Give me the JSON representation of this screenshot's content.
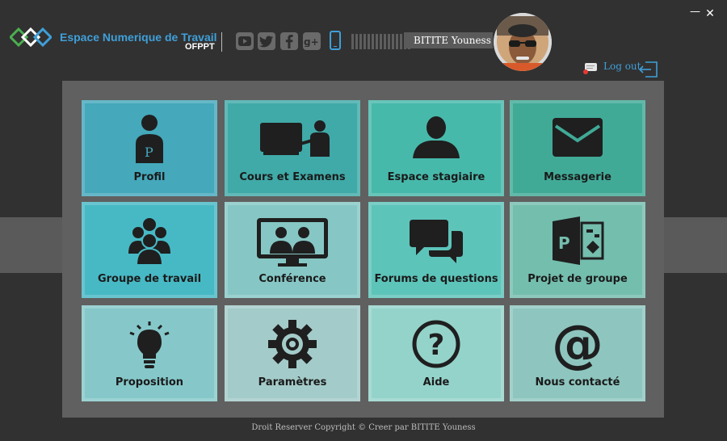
{
  "header": {
    "title": "Espace Numerique de Travail",
    "subtitle": "OFPPT",
    "user_name": "BITITE Youness",
    "logout_label": "Log out",
    "accent_color": "#3f9fd9"
  },
  "social_icons": [
    "youtube-icon",
    "twitter-icon",
    "facebook-icon",
    "google-plus-icon"
  ],
  "tiles": [
    {
      "label": "Profil",
      "icon": "profile-icon",
      "color": "#45a8bb"
    },
    {
      "label": "Cours et Examens",
      "icon": "teacher-board-icon",
      "color": "#40aaa8"
    },
    {
      "label": "Espace stagiaire",
      "icon": "user-icon",
      "color": "#47b9ab"
    },
    {
      "label": "Messagerie",
      "icon": "envelope-icon",
      "color": "#40aa97"
    },
    {
      "label": "Groupe de travail",
      "icon": "group-icon",
      "color": "#47b9c5"
    },
    {
      "label": "Conférence",
      "icon": "video-conference-icon",
      "color": "#86c7c5"
    },
    {
      "label": "Forums de questions",
      "icon": "forum-chat-icon",
      "color": "#5dc4ba"
    },
    {
      "label": "Projet de groupe",
      "icon": "project-icon",
      "color": "#74beae"
    },
    {
      "label": "Proposition",
      "icon": "lightbulb-icon",
      "color": "#86c8ca"
    },
    {
      "label": "Paramètres",
      "icon": "gear-icon",
      "color": "#a3cbc9"
    },
    {
      "label": "Aide",
      "icon": "help-icon",
      "color": "#94d3ca"
    },
    {
      "label": "Nous contacté",
      "icon": "at-sign-icon",
      "color": "#8ec6bf"
    }
  ],
  "footer": {
    "text": "Droit Reserver Copyright © Creer par BITITE Youness"
  }
}
